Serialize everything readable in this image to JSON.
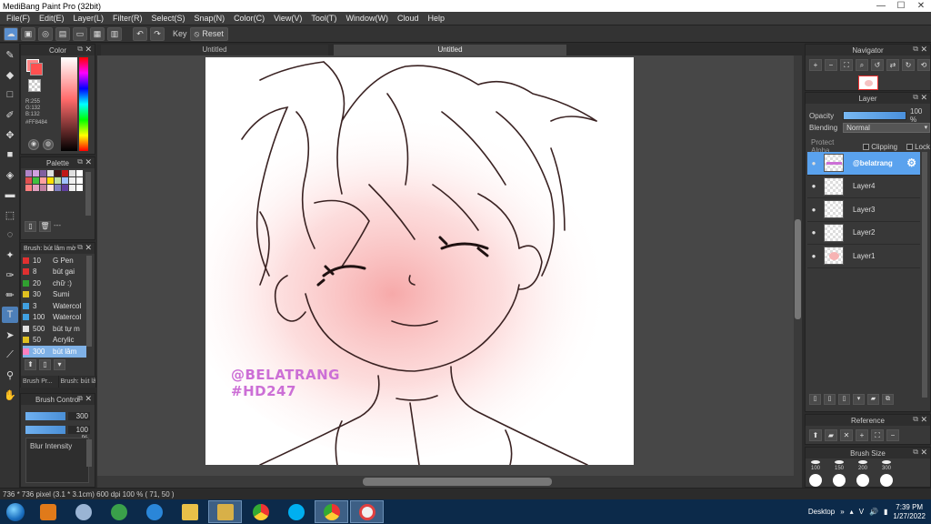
{
  "window": {
    "title": "MediBang Paint Pro (32bit)",
    "minimize": "—",
    "maximize": "☐",
    "close": "✕"
  },
  "menu": [
    "File(F)",
    "Edit(E)",
    "Layer(L)",
    "Filter(R)",
    "Select(S)",
    "Snap(N)",
    "Color(C)",
    "View(V)",
    "Tool(T)",
    "Window(W)",
    "Cloud",
    "Help"
  ],
  "toolbar": {
    "key_label": "Key",
    "reset_label": "Reset"
  },
  "color_panel": {
    "title": "Color",
    "r": "R:255",
    "g": "G:132",
    "b": "B:132",
    "hex": "#FF8484",
    "fg": "#ff8484"
  },
  "palette_panel": {
    "title": "Palette",
    "ellipsis": "---",
    "swatches": [
      "#b084c8",
      "#d0a0e0",
      "#8060a0",
      "#e0e0e0",
      "#401818",
      "#c01818",
      "#e0e0e0",
      "#ffffff",
      "#e05050",
      "#40c040",
      "#ffa0a0",
      "#ffe000",
      "#c0e0a0",
      "#a0c0ff",
      "#f0f0f0",
      "#ffffff",
      "#ff8080",
      "#e0a0c0",
      "#c080a0",
      "#ffe0e0",
      "#8080c0",
      "#6040a0",
      "#f0f0f0",
      "#ffffff"
    ]
  },
  "brush_panel": {
    "title": "Brush: bút lâm mờ",
    "items": [
      {
        "size": "10",
        "name": "G Pen",
        "color": "#e03030"
      },
      {
        "size": "8",
        "name": "bút gai",
        "color": "#e03030"
      },
      {
        "size": "20",
        "name": "chữ :)",
        "color": "#30a030"
      },
      {
        "size": "30",
        "name": "Sumi",
        "color": "#e0c020"
      },
      {
        "size": "3",
        "name": "Watercol",
        "color": "#40a0e0"
      },
      {
        "size": "100",
        "name": "Watercol",
        "color": "#40a0e0"
      },
      {
        "size": "500",
        "name": "bút tự m",
        "color": "#e0e0e0"
      },
      {
        "size": "50",
        "name": "Acrylic",
        "color": "#e0c020"
      },
      {
        "size": "300",
        "name": "bút lâm",
        "color": "#ff80c0"
      }
    ],
    "tab1": "Brush Pr...",
    "tab2": "Brush: bút lâ..."
  },
  "brush_control": {
    "title": "Brush Control",
    "size": "300",
    "opacity": "100 %",
    "blur_label": "Blur Intensity"
  },
  "canvas": {
    "tab1": "Untitled",
    "tab2": "Untitled",
    "watermark1": "@BELATRANG",
    "watermark2": "#HD247"
  },
  "navigator": {
    "title": "Navigator"
  },
  "layer_panel": {
    "title": "Layer",
    "opacity_label": "Opacity",
    "opacity_value": "100 %",
    "blending_label": "Blending",
    "blending_value": "Normal",
    "protect_alpha": "Protect Alpha",
    "clipping": "Clipping",
    "lock": "Lock",
    "layers": [
      "@belatrang",
      "Layer4",
      "Layer3",
      "Layer2",
      "Layer1"
    ]
  },
  "reference": {
    "title": "Reference"
  },
  "brush_size": {
    "title": "Brush Size",
    "sizes": [
      "100",
      "150",
      "200",
      "300"
    ]
  },
  "status": {
    "text": "736 * 736 pixel  (3.1 * 3.1cm)  600 dpi  100 %  ( 71, 50 )"
  },
  "taskbar": {
    "desktop": "Desktop",
    "time": "7:39 PM",
    "date": "1/27/2022",
    "lang": "V"
  }
}
